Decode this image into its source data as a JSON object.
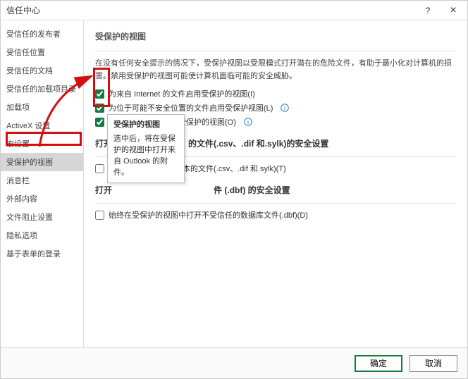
{
  "window": {
    "title": "信任中心",
    "help_label": "?",
    "close_label": "×"
  },
  "sidebar": {
    "items": [
      {
        "label": "受信任的发布者"
      },
      {
        "label": "受信任位置"
      },
      {
        "label": "受信任的文档"
      },
      {
        "label": "受信任的加载项目录"
      },
      {
        "label": "加载项"
      },
      {
        "label": "ActiveX 设置"
      },
      {
        "label": "宏设置"
      },
      {
        "label": "受保护的视图"
      },
      {
        "label": "消息栏"
      },
      {
        "label": "外部内容"
      },
      {
        "label": "文件阻止设置"
      },
      {
        "label": "隐私选项"
      },
      {
        "label": "基于表单的登录"
      }
    ],
    "active_index": 7
  },
  "content": {
    "section1": {
      "title": "受保护的视图",
      "desc": "在没有任何安全提示的情况下，受保护视图以受限模式打开潜在的危险文件，有助于最小化对计算机的损害。禁用受保护的视图可能使计算机面临可能的安全威胁。",
      "options": [
        {
          "label": "为来自 Internet 的文件启用受保护的视图(I)",
          "checked": true
        },
        {
          "label": "为位于可能不安全位置的文件启用受保护视图(L)",
          "checked": true,
          "help": true
        },
        {
          "label": "为 Outlook 附件启用受保护的视图(O)",
          "checked": true,
          "help": true
        }
      ]
    },
    "section2": {
      "title_full": "打开某些类型的基于文本的文件(.csv、.dif 和.sylk)的安全设置",
      "title_prefix": "打开",
      "title_suffix": "的文件(.csv、.dif 和.sylk)的安全设置",
      "option": {
        "label": "受信任的基于文本的文件(.csv、.dif 和.sylk)(T)",
        "checked": false
      }
    },
    "section3": {
      "title_full": "打开来自不受信任的源数据库文件 (.dbf) 的安全设置",
      "title_prefix": "打开",
      "title_suffix": "件 (.dbf) 的安全设置",
      "option": {
        "label": "始终在受保护的视图中打开不受信任的数据库文件(.dbf)(D)",
        "checked": false
      }
    }
  },
  "tooltip": {
    "title": "受保护的视图",
    "body": "选中后，将在受保护的视图中打开来自 Outlook 的附件。"
  },
  "footer": {
    "ok": "确定",
    "cancel": "取消"
  }
}
